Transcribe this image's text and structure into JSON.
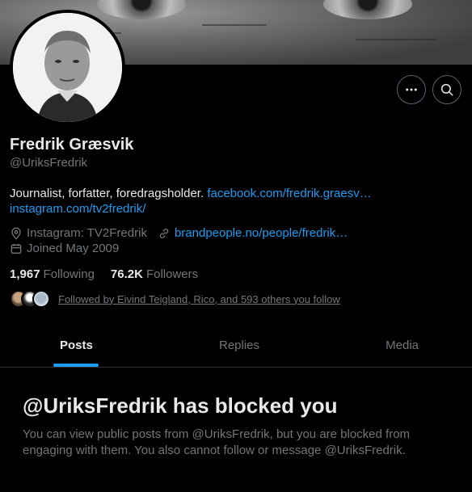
{
  "profile": {
    "display_name": "Fredrik Græsvik",
    "handle": "@UriksFredrik",
    "bio_text": "Journalist, forfatter, foredragsholder. ",
    "bio_link1": "facebook.com/fredrik.graesv…",
    "bio_link2": "instagram.com/tv2fredrik/",
    "location": "Instagram: TV2Fredrik",
    "website": "brandpeople.no/people/fredrik…",
    "joined": "Joined May 2009",
    "following_count": "1,967",
    "following_label": "Following",
    "followers_count": "76.2K",
    "followers_label": "Followers",
    "followed_by": "Followed by Eivind Teigland, Rico, and 593 others you follow"
  },
  "tabs": [
    {
      "label": "Posts",
      "active": true
    },
    {
      "label": "Replies",
      "active": false
    },
    {
      "label": "Media",
      "active": false
    }
  ],
  "blocked_notice": {
    "title": "@UriksFredrik has blocked you",
    "message": "You can view public posts from @UriksFredrik, but you are blocked from engaging with them. You also cannot follow or message @UriksFredrik."
  },
  "colors": {
    "background": "#000000",
    "accent": "#1d9bf0",
    "secondary_text": "#71767b",
    "primary_text": "#e7e9ea"
  },
  "icons": [
    "more-icon",
    "search-icon",
    "location-icon",
    "link-icon",
    "calendar-icon"
  ]
}
